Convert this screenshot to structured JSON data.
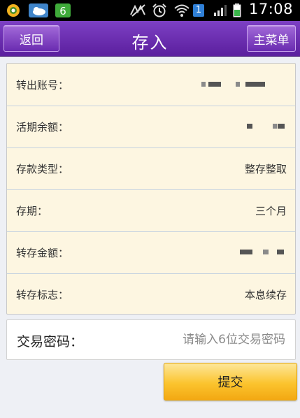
{
  "status_bar": {
    "time": "17:08",
    "sim_badge": "1",
    "icons": [
      "browser-app-icon",
      "weather-app-icon",
      "phone-app-icon",
      "no-signal-icon",
      "alarm-icon",
      "wifi-icon",
      "sim-badge-icon",
      "cellular-signal-icon",
      "battery-icon"
    ]
  },
  "header": {
    "back_label": "返回",
    "title": "存入",
    "menu_label": "主菜单"
  },
  "details": {
    "rows": [
      {
        "label": "转出账号：",
        "value": ""
      },
      {
        "label": "活期余额：",
        "value": ""
      },
      {
        "label": "存款类型：",
        "value": "整存整取"
      },
      {
        "label": "存期：",
        "value": "三个月"
      },
      {
        "label": "转存金额：",
        "value": ""
      },
      {
        "label": "转存标志：",
        "value": "本息续存"
      }
    ]
  },
  "password": {
    "label": "交易密码：",
    "placeholder": "请输入6位交易密码"
  },
  "submit_label": "提交",
  "colors": {
    "header_purple": "#6a2bb0",
    "panel_cream": "#fdf6e1",
    "submit_orange": "#fbc42e"
  }
}
